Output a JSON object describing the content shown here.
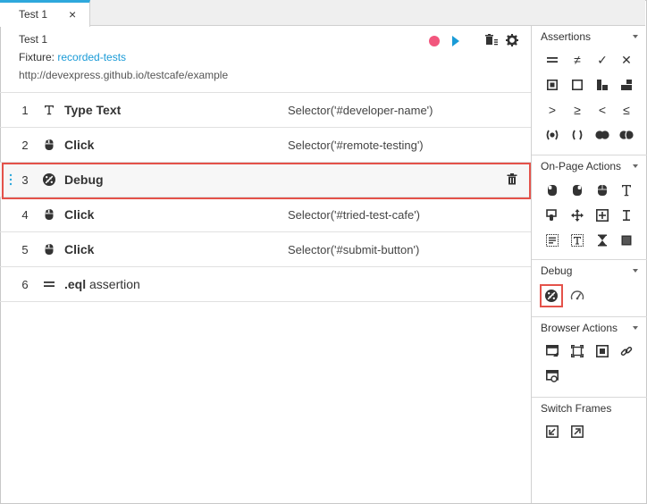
{
  "tab": {
    "label": "Test 1",
    "close": "×"
  },
  "test": {
    "name": "Test 1",
    "fixture_label": "Fixture:",
    "fixture_value": "recorded-tests",
    "url": "http://devexpress.github.io/testcafe/example"
  },
  "steps": [
    {
      "num": "1",
      "icon": "type-text-icon",
      "name": "Type Text",
      "selector": "Selector('#developer-name')"
    },
    {
      "num": "2",
      "icon": "mouse-click-icon",
      "name": "Click",
      "selector": "Selector('#remote-testing')"
    },
    {
      "num": "3",
      "icon": "debug-icon",
      "name": "Debug",
      "selector": ""
    },
    {
      "num": "4",
      "icon": "mouse-click-icon",
      "name": "Click",
      "selector": "Selector('#tried-test-cafe')"
    },
    {
      "num": "5",
      "icon": "mouse-click-icon",
      "name": "Click",
      "selector": "Selector('#submit-button')"
    },
    {
      "num": "6",
      "icon": "eql-icon",
      "name": ".eql",
      "name_suffix": " assertion",
      "selector": ""
    }
  ],
  "side": {
    "assertions": "Assertions",
    "on_page_actions": "On-Page Actions",
    "debug": "Debug",
    "browser_actions": "Browser Actions",
    "switch_frames": "Switch Frames",
    "assert_ne_glyph": "≠",
    "assert_ok_glyph": "✓",
    "assert_notok_glyph": "✕",
    "assert_gt_glyph": ">",
    "assert_gte_glyph": "≥",
    "assert_lt_glyph": "<",
    "assert_lte_glyph": "≤"
  },
  "colors": {
    "accent": "#1a9bd7",
    "record": "#f2567d",
    "highlight": "#e4524a",
    "tab_top": "#2ea8dc"
  }
}
